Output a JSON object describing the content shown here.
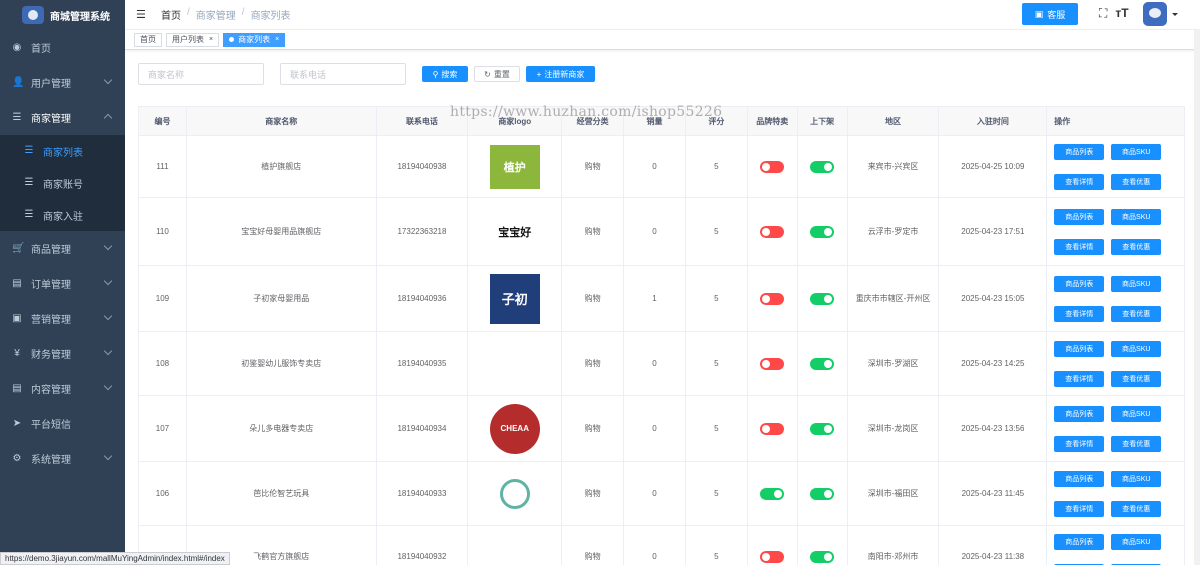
{
  "sidebar": {
    "title": "商城管理系统",
    "menu": [
      {
        "label": "首页",
        "icon": "dashboard-icon"
      },
      {
        "label": "用户管理",
        "icon": "user-icon"
      },
      {
        "label": "商家管理",
        "icon": "list-icon"
      },
      {
        "label": "商品管理",
        "icon": "cart-icon"
      },
      {
        "label": "订单管理",
        "icon": "book-icon"
      },
      {
        "label": "营销管理",
        "icon": "gift-icon"
      },
      {
        "label": "财务管理",
        "icon": "yen-icon"
      },
      {
        "label": "内容管理",
        "icon": "book-icon"
      },
      {
        "label": "平台短信",
        "icon": "send-icon"
      },
      {
        "label": "系统管理",
        "icon": "gear-icon"
      }
    ],
    "submenu": [
      {
        "label": "商家列表",
        "active": true
      },
      {
        "label": "商家账号",
        "active": false
      },
      {
        "label": "商家入驻",
        "active": false
      }
    ],
    "status_url": "https://demo.3jiayun.com/mallMuYingAdmin/index.html#/index"
  },
  "header": {
    "breadcrumb": [
      "首页",
      "商家管理",
      "商家列表"
    ],
    "kefu_label": "客服",
    "accent": "#1890ff"
  },
  "tags": [
    {
      "label": "首页",
      "active": false,
      "closable": false
    },
    {
      "label": "用户列表",
      "active": false,
      "closable": true
    },
    {
      "label": "商家列表",
      "active": true,
      "closable": true
    }
  ],
  "filter": {
    "name_placeholder": "商家名称",
    "phone_placeholder": "联系电话",
    "search_label": "搜索",
    "reset_label": "重置",
    "register_label": "注册新商家"
  },
  "watermark": "https://www.huzhan.com/ishop55226",
  "table": {
    "columns": [
      "编号",
      "商家名称",
      "联系电话",
      "商家logo",
      "经营分类",
      "销量",
      "评分",
      "品牌特卖",
      "上下架",
      "地区",
      "入驻时间",
      "操作"
    ],
    "ops": [
      "商品列表",
      "商品SKU",
      "查看详情",
      "查看优惠"
    ],
    "rows": [
      {
        "id": "111",
        "name": "植护旗舰店",
        "phone": "18194040938",
        "logo_text": "植护",
        "category": "购物",
        "sales": "0",
        "score": "5",
        "brand_sale": false,
        "on_shelf": true,
        "region": "来宾市-兴宾区",
        "time": "2025-04-25 10:09"
      },
      {
        "id": "110",
        "name": "宝宝好母婴用品旗舰店",
        "phone": "17322363218",
        "logo_text": "宝宝好",
        "category": "购物",
        "sales": "0",
        "score": "5",
        "brand_sale": false,
        "on_shelf": true,
        "region": "云浮市-罗定市",
        "time": "2025-04-23 17:51"
      },
      {
        "id": "109",
        "name": "子初家母婴用品",
        "phone": "18194040936",
        "logo_text": "子初",
        "category": "购物",
        "sales": "1",
        "score": "5",
        "brand_sale": false,
        "on_shelf": true,
        "region": "重庆市市辖区-开州区",
        "time": "2025-04-23 15:05"
      },
      {
        "id": "108",
        "name": "初鉴婴幼儿服饰专卖店",
        "phone": "18194040935",
        "logo_text": "",
        "category": "购物",
        "sales": "0",
        "score": "5",
        "brand_sale": false,
        "on_shelf": true,
        "region": "深圳市-罗湖区",
        "time": "2025-04-23 14:25"
      },
      {
        "id": "107",
        "name": "朵儿多电器专卖店",
        "phone": "18194040934",
        "logo_text": "CHEAA",
        "category": "购物",
        "sales": "0",
        "score": "5",
        "brand_sale": false,
        "on_shelf": true,
        "region": "深圳市-龙岗区",
        "time": "2025-04-23 13:56"
      },
      {
        "id": "106",
        "name": "芭比伦智艺玩具",
        "phone": "18194040933",
        "logo_text": "",
        "category": "购物",
        "sales": "0",
        "score": "5",
        "brand_sale": true,
        "on_shelf": true,
        "region": "深圳市-福田区",
        "time": "2025-04-23 11:45"
      },
      {
        "id": "105",
        "name": "飞鹤官方旗舰店",
        "phone": "18194040932",
        "logo_text": "",
        "category": "购物",
        "sales": "0",
        "score": "5",
        "brand_sale": false,
        "on_shelf": true,
        "region": "南阳市-邓州市",
        "time": "2025-04-23 11:38"
      }
    ]
  }
}
